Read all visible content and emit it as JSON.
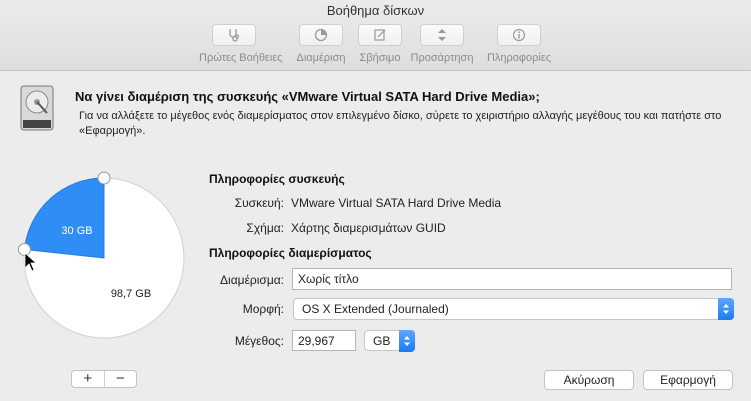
{
  "window": {
    "title": "Βοήθημα δίσκων"
  },
  "toolbar": {
    "items": [
      {
        "label": "Πρώτες Βοήθειες",
        "icon": "stethoscope-icon"
      },
      {
        "label": "Διαμέριση",
        "icon": "partition-icon"
      },
      {
        "label": "Σβήσιμο",
        "icon": "erase-icon"
      },
      {
        "label": "Προσάρτηση",
        "icon": "mount-icon"
      },
      {
        "label": "Πληροφορίες",
        "icon": "info-icon"
      }
    ]
  },
  "dialog": {
    "heading": "Να γίνει διαμέριση της συσκευής «VMware Virtual SATA Hard Drive Media»;",
    "description": "Για να αλλάξετε το μέγεθος ενός διαμερίσματος στον επιλεγμένο δίσκο, σύρετε το χειριστήριο αλλαγής μεγέθους του και πατήστε στο «Εφαρμογή».",
    "pie": {
      "selected_label": "30 GB",
      "free_label": "98,7 GB",
      "selected_fraction": 0.233,
      "selected_color": "#2f8ef5",
      "free_color": "#ffffff"
    },
    "device_info": {
      "title": "Πληροφορίες συσκευής",
      "device_label": "Συσκευή:",
      "device_value": "VMware Virtual SATA Hard Drive Media",
      "scheme_label": "Σχήμα:",
      "scheme_value": "Χάρτης διαμερισμάτων GUID"
    },
    "partition_info": {
      "title": "Πληροφορίες διαμερίσματος",
      "name_label": "Διαμέρισμα:",
      "name_value": "Χωρίς τίτλο",
      "format_label": "Μορφή:",
      "format_value": "OS X Extended (Journaled)",
      "size_label": "Μέγεθος:",
      "size_value": "29,967",
      "size_unit": "GB"
    },
    "buttons": {
      "add": "+",
      "remove": "−",
      "cancel": "Ακύρωση",
      "apply": "Εφαρμογή"
    }
  },
  "colors": {
    "accent": "#2f8ef5"
  }
}
